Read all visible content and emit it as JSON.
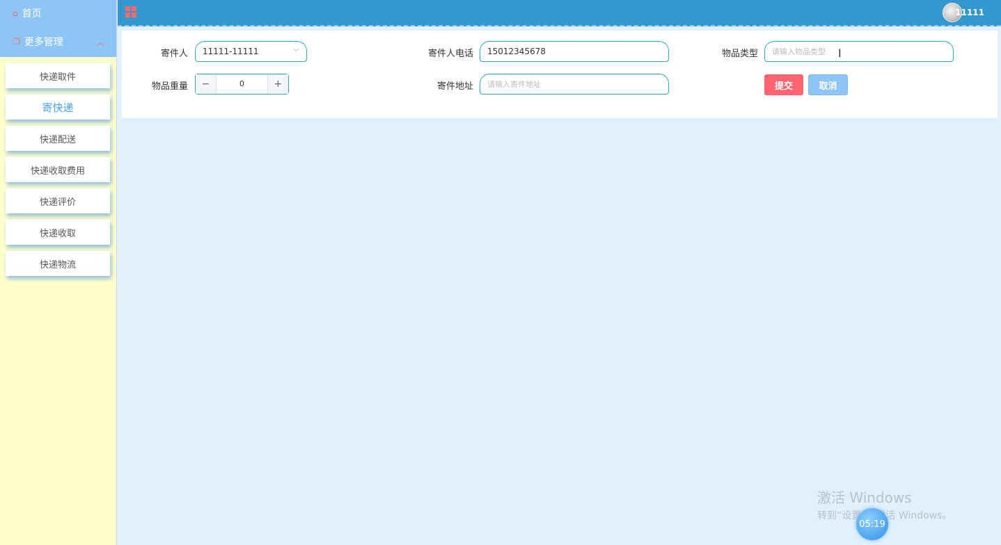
{
  "sidebar": {
    "home_label": "首页",
    "group_label": "更多管理",
    "items": [
      {
        "label": "快递取件"
      },
      {
        "label": "寄快递"
      },
      {
        "label": "快递配送"
      },
      {
        "label": "快递收取费用"
      },
      {
        "label": "快递评价"
      },
      {
        "label": "快递收取"
      },
      {
        "label": "快递物流"
      }
    ],
    "active_index": 1
  },
  "header": {
    "username": "11111"
  },
  "form": {
    "sender_label": "寄件人",
    "sender_value": "11111-11111",
    "phone_label": "寄件人电话",
    "phone_value": "15012345678",
    "type_label": "物品类型",
    "type_placeholder": "请输入物品类型",
    "weight_label": "物品重量",
    "weight_value": "0",
    "weight_minus": "−",
    "weight_plus": "+",
    "address_label": "寄件地址",
    "address_placeholder": "请输入寄件地址",
    "submit_label": "提交",
    "cancel_label": "取消"
  },
  "overlay": {
    "watermark_line1": "激活 Windows",
    "watermark_line2": "转到“设置”以激活 Windows。",
    "clock": "05:19"
  },
  "colors": {
    "topbar": "#3498cf",
    "sidebar_head": "#8ec5f7",
    "sidebar_bg": "#ffffcc",
    "submit": "#ff6470",
    "cancel": "#8ec5f7",
    "content_bg": "#e1f0fd"
  }
}
